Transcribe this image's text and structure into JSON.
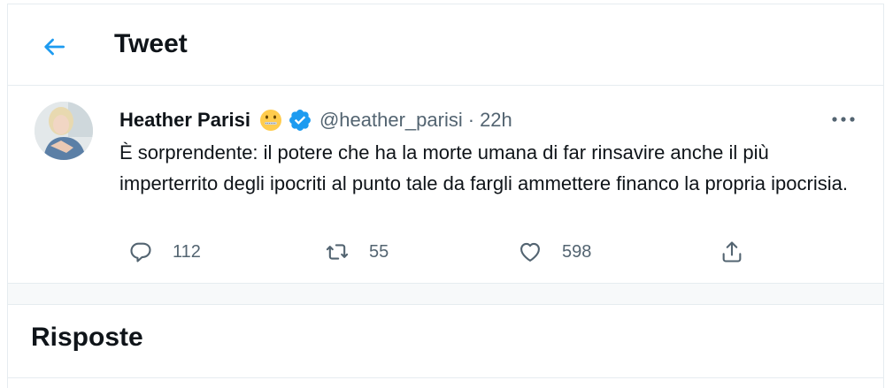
{
  "header": {
    "title": "Tweet",
    "back_icon": "arrow-left-icon"
  },
  "tweet": {
    "author_name": "Heather Parisi",
    "author_emoji": "zipper-mouth-face",
    "verified": true,
    "handle": "@heather_parisi",
    "separator": "·",
    "time": "22h",
    "text": "È sorprendente: il potere che ha la morte umana di far rinsavire anche il più imperterrito degli ipocriti al punto tale da fargli ammettere financo la propria ipocrisia.",
    "actions": {
      "reply_count": "112",
      "retweet_count": "55",
      "like_count": "598"
    }
  },
  "replies": {
    "title": "Risposte"
  },
  "colors": {
    "accent": "#1d9bf0",
    "text": "#0f1419",
    "secondary": "#536471",
    "border": "#e6ecf0"
  }
}
